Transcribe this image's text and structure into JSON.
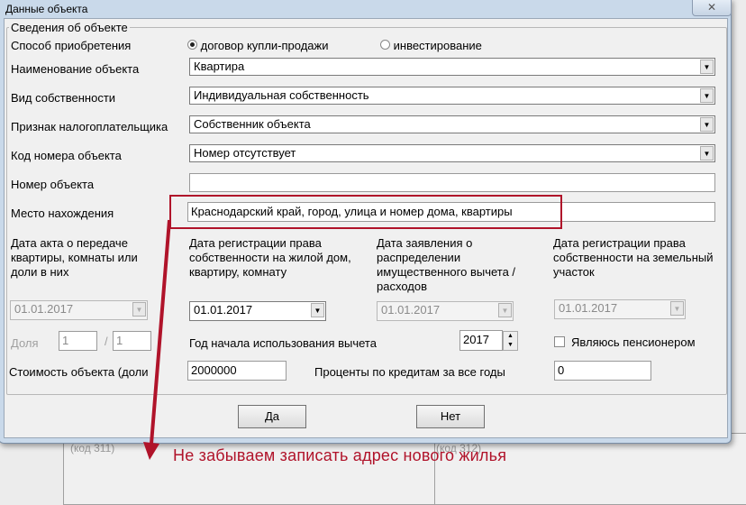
{
  "background": {
    "code_311": "(код 311)",
    "code_312": "(код 312)"
  },
  "dialog": {
    "title": "Данные объекта",
    "close_icon": "close-icon",
    "group_title": "Сведения об объекте",
    "acquisition_label": "Способ приобретения",
    "acquisition_options": [
      "договор купли-продажи",
      "инвестирование"
    ],
    "acquisition_selected": 0,
    "object_name_label": "Наименование объекта",
    "object_name_value": "Квартира",
    "ownership_label": "Вид собственности",
    "ownership_value": "Индивидуальная собственность",
    "taxpayer_label": "Признак налогоплательщика",
    "taxpayer_value": "Собственник объекта",
    "number_code_label": "Код номера объекта",
    "number_code_value": "Номер отсутствует",
    "object_number_label": "Номер объекта",
    "object_number_value": "",
    "location_label": "Место нахождения",
    "location_value": "Краснодарский край, город, улица и номер дома, квартиры",
    "date_cols": [
      {
        "label": "Дата акта о передаче квартиры, комнаты или доли в них",
        "value": "01.01.2017",
        "enabled": false
      },
      {
        "label": "Дата регистрации права собственности на жилой дом, квартиру, комнату",
        "value": "01.01.2017",
        "enabled": true
      },
      {
        "label": "Дата заявления о распределении имущественного вычета / расходов",
        "value": "01.01.2017",
        "enabled": false
      },
      {
        "label": "Дата регистрации права собственности на земельный участок",
        "value": "01.01.2017",
        "enabled": false
      }
    ],
    "share_label": "Доля",
    "share_num": "1",
    "share_sep": "/",
    "share_den": "1",
    "year_label": "Год начала использования вычета",
    "year_value": "2017",
    "pensioner_label": "Являюсь пенсионером",
    "pensioner_checked": false,
    "cost_label": "Стоимость объекта (доли",
    "cost_value": "2000000",
    "interest_label": "Проценты по кредитам за все годы",
    "interest_value": "0",
    "yes_label": "Да",
    "no_label": "Нет"
  },
  "annotation": {
    "text": "Не забываем записать адрес нового жилья",
    "color": "#b0132a"
  }
}
